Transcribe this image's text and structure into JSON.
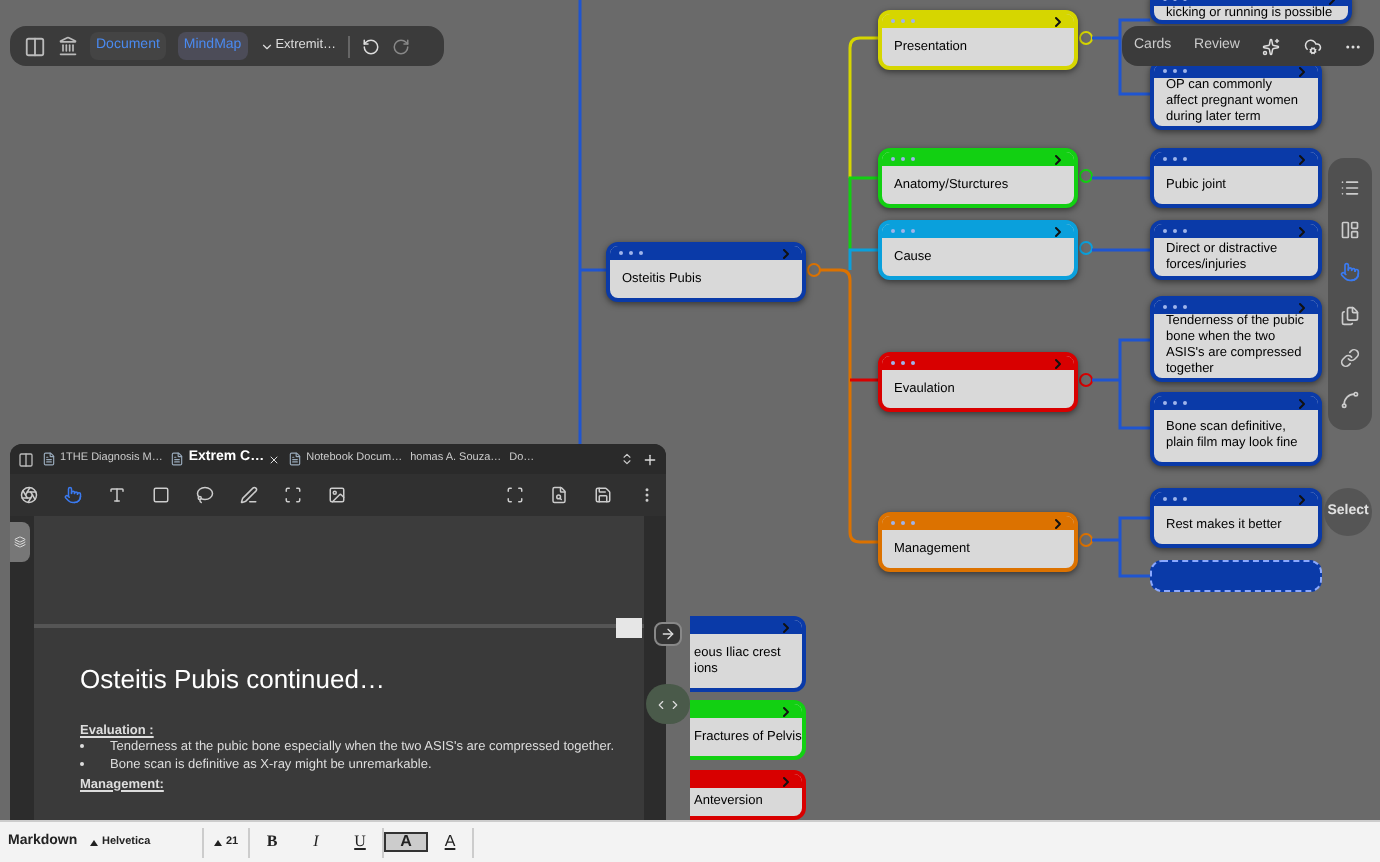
{
  "top_toolbar": {
    "tabs": [
      {
        "label": "Document",
        "selected": false
      },
      {
        "label": "MindMap",
        "selected": true
      }
    ],
    "dropdown": "Extremit…"
  },
  "card_toolbar": {
    "buttons": [
      "Cards",
      "Review"
    ]
  },
  "mindmap": {
    "root": {
      "text": "Osteitis Pubis",
      "color": "#0a3aa8",
      "children": [
        {
          "text": "Presentation",
          "color": "#d6d600",
          "children": [
            {
              "text": "kicking or running is possible",
              "color": "#0a3aa8",
              "kind": "node"
            },
            {
              "text": "OP can commonly affect pregnant women during later term",
              "color": "#0a3aa8",
              "kind": "node"
            }
          ]
        },
        {
          "text": "Anatomy/Sturctures",
          "color": "#12d012",
          "children": [
            {
              "text": "Pubic joint",
              "color": "#0a3aa8",
              "kind": "node"
            }
          ]
        },
        {
          "text": "Cause",
          "color": "#0aa0dc",
          "children": [
            {
              "text": "Direct or distractive forces/injuries",
              "color": "#0a3aa8",
              "kind": "node"
            }
          ]
        },
        {
          "text": "Evaulation",
          "color": "#d80000",
          "children": [
            {
              "text": "Tenderness of the pubic bone when the two ASIS's are compressed together",
              "color": "#0a3aa8",
              "kind": "node"
            },
            {
              "text": "Bone scan definitive, plain film may look fine",
              "color": "#0a3aa8",
              "kind": "node"
            }
          ]
        },
        {
          "text": "Management",
          "color": "#dc7200",
          "children": [
            {
              "text": "Rest makes it better",
              "color": "#0a3aa8",
              "kind": "node"
            },
            {
              "color": "#0a3aa8",
              "kind": "empty"
            }
          ]
        }
      ]
    },
    "partial_nodes": [
      {
        "text": "eous Iliac crest\nions",
        "color": "#0a3aa8"
      },
      {
        "text": "Fractures of Pelvis",
        "color": "#12d012"
      },
      {
        "text": "Anteversion",
        "color": "#d80000"
      }
    ]
  },
  "select_button": "Select",
  "document_window": {
    "tabs": [
      {
        "label": "1THE Diagnosis M…",
        "selected": false
      },
      {
        "label": "Extrem C…",
        "selected": true
      },
      {
        "label": "Notebook Docum…",
        "selected": false
      },
      {
        "label": "homas A. Souza…",
        "selected": false
      },
      {
        "label": "Do…",
        "selected": false
      }
    ],
    "page": {
      "heading": "Osteitis Pubis continued…",
      "sections": [
        {
          "title": "Evaluation :",
          "bullets": [
            "Tenderness at the pubic bone especially when the two ASIS's are compressed together.",
            "Bone scan is definitive as X-ray might be unremarkable."
          ]
        },
        {
          "title": "Management:"
        }
      ]
    }
  },
  "format_bar": {
    "mode": "Markdown",
    "font": "Helvetica",
    "size": "21",
    "buttons": [
      {
        "label": "B",
        "kind": "bold"
      },
      {
        "label": "I",
        "kind": "italic"
      },
      {
        "label": "U",
        "kind": "underline"
      },
      {
        "label": "A",
        "kind": "highlight"
      },
      {
        "label": "A",
        "kind": "color"
      }
    ]
  }
}
